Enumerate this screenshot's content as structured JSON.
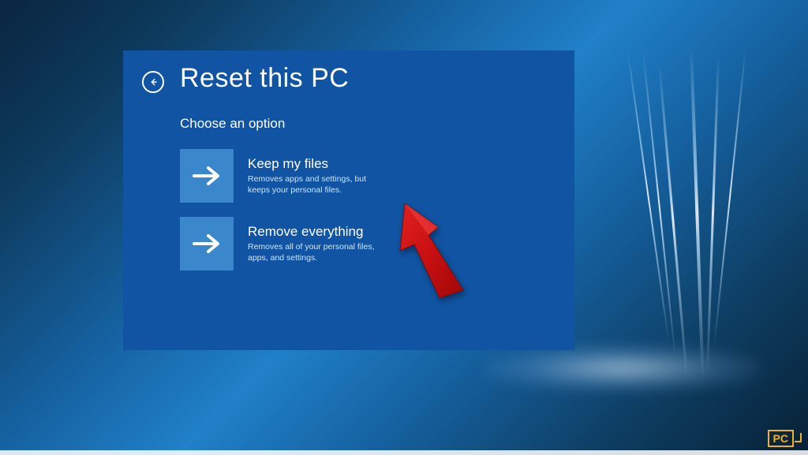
{
  "dialog": {
    "title": "Reset this PC",
    "subtitle": "Choose an option",
    "options": [
      {
        "title": "Keep my files",
        "description": "Removes apps and settings, but keeps your personal files."
      },
      {
        "title": "Remove everything",
        "description": "Removes all of your personal files, apps, and settings."
      }
    ]
  },
  "watermark": {
    "label": "PC"
  }
}
